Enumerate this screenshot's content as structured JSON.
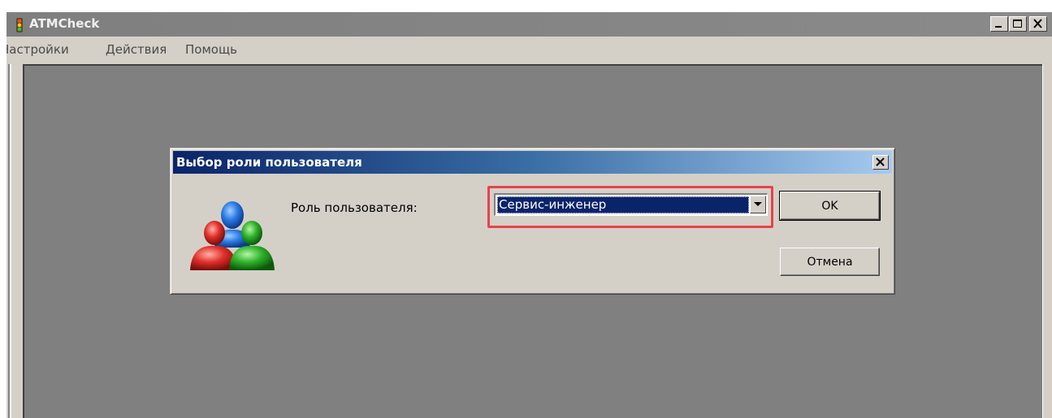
{
  "app": {
    "title": "ATMCheck",
    "menu": [
      "Настройки",
      "Действия",
      "Помощь"
    ]
  },
  "dialog": {
    "title": "Выбор роли пользователя",
    "role_label": "Роль пользователя:",
    "role_value": "Сервис-инженер",
    "ok_label": "OK",
    "cancel_label": "Отмена"
  },
  "colors": {
    "highlight": "#e8424b",
    "selection": "#0a246a"
  },
  "icons": {
    "app": "traffic-light-icon",
    "users": "users-group-icon"
  }
}
